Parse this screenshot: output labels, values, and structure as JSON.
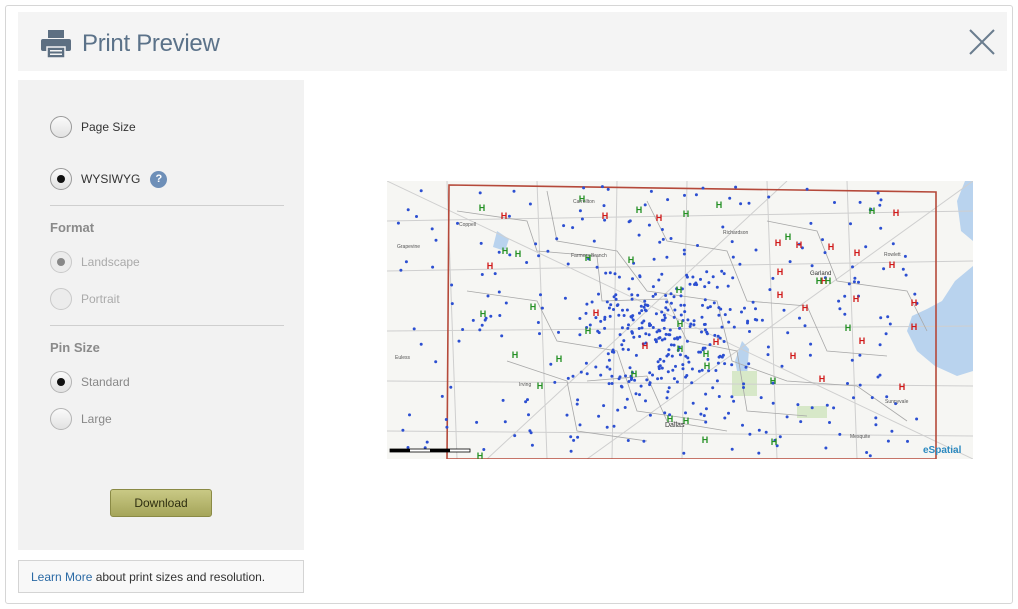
{
  "header": {
    "title": "Print Preview"
  },
  "sidebar": {
    "page_size_label": "Page Size",
    "wysiwyg_label": "WYSIWYG",
    "help_glyph": "?",
    "format": {
      "title": "Format",
      "landscape_label": "Landscape",
      "portrait_label": "Portrait"
    },
    "pin_size": {
      "title": "Pin Size",
      "standard_label": "Standard",
      "large_label": "Large"
    },
    "download_label": "Download"
  },
  "footer": {
    "link_text": "Learn More",
    "rest_text": " about print sizes and resolution."
  },
  "map": {
    "brand": "eSpatial",
    "place_labels": [
      "Richardson",
      "Garland",
      "Irving",
      "Dallas",
      "Mesquite",
      "Coppell",
      "Grapevine",
      "Farmers Branch",
      "Carrollton",
      "Rowlett",
      "Euless",
      "Sunnyvale"
    ]
  },
  "selected": {
    "print_mode": "WYSIWYG",
    "format": "Landscape",
    "pin_size": "Standard"
  },
  "colors": {
    "title": "#5b7289",
    "boundary": "#b5493a",
    "pin_dot": "#2c4fd1",
    "marker_red": "#d01919",
    "marker_green": "#249024",
    "water": "#b9d3ee",
    "accent_button": "#b0b066"
  }
}
